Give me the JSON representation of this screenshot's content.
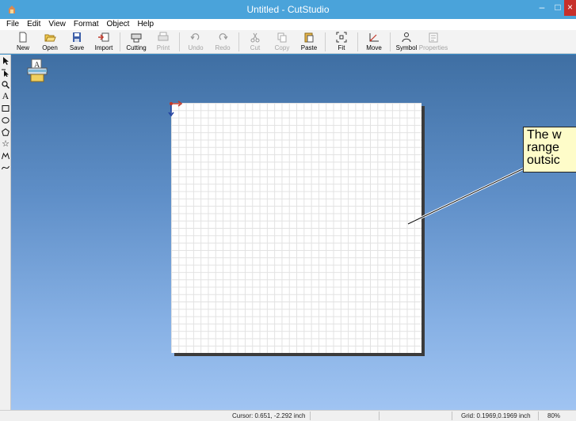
{
  "window": {
    "title": "Untitled - CutStudio",
    "minimize_glyph": "–",
    "maximize_glyph": "□",
    "close_glyph": "×"
  },
  "menu": [
    "File",
    "Edit",
    "View",
    "Format",
    "Object",
    "Help"
  ],
  "toolbar": {
    "new": "New",
    "open": "Open",
    "save": "Save",
    "import": "Import",
    "cutting": "Cutting",
    "print": "Print",
    "undo": "Undo",
    "redo": "Redo",
    "cut": "Cut",
    "copy": "Copy",
    "paste": "Paste",
    "fit": "Fit",
    "move": "Move",
    "symbol": "Symbol",
    "properties": "Properties"
  },
  "palette": {
    "text_tool": "A",
    "star_tool": "☆"
  },
  "workspace": {
    "callout_text": "The w\nrange\noutsic"
  },
  "status": {
    "cursor": "Cursor: 0.651, -2.292 inch",
    "grid": "Grid: 0.1969,0.1969 inch",
    "zoom": "80%"
  },
  "colors": {
    "titlebar": "#4aa3da",
    "close_button": "#c7302b",
    "callout_fill": "#fefcc9"
  },
  "icons": [
    "app-icon",
    "new-icon",
    "open-icon",
    "save-icon",
    "import-icon",
    "cutting-icon",
    "print-icon",
    "undo-icon",
    "redo-icon",
    "cut-icon",
    "copy-icon",
    "paste-icon",
    "fit-icon",
    "move-icon",
    "symbol-icon",
    "properties-icon",
    "select-arrow-icon",
    "node-edit-icon",
    "zoom-icon",
    "rectangle-icon",
    "ellipse-icon",
    "polygon-icon",
    "star-icon",
    "polyline-icon",
    "curve-icon"
  ]
}
